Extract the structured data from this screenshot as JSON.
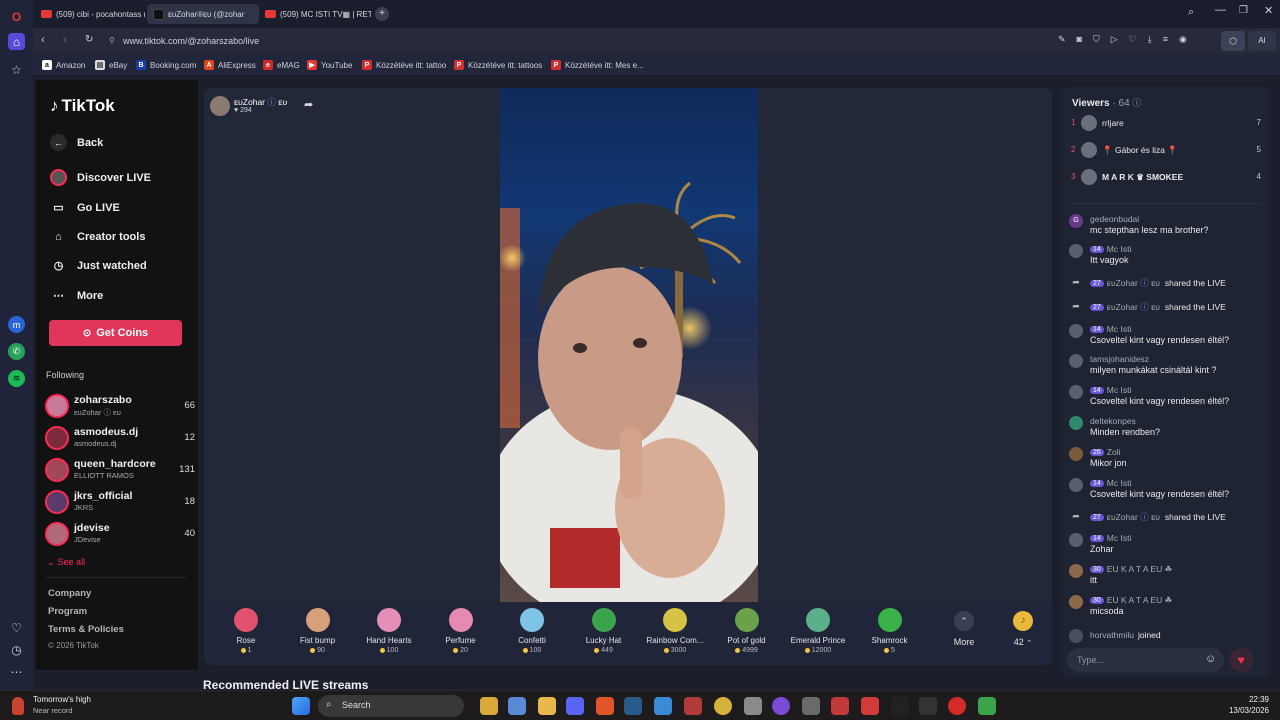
{
  "browser": {
    "tabs": [
      {
        "label": "(509) cibi - pocahontass (",
        "kind": "yt"
      },
      {
        "label": "ᴇᴜZohar®ᴇᴜ (@zohar",
        "kind": "tt"
      },
      {
        "label": "(509) MC ISTI TV▦ | RETE",
        "kind": "yt"
      }
    ],
    "new_tab_label": "+",
    "url": "www.tiktok.com/@zoharszabo/live",
    "ai_label": "AI",
    "bookmarks": [
      "Amazon",
      "eBay",
      "Booking.com",
      "AliExpress",
      "eMAG",
      "YouTube",
      "Közzétéve itt: tattoo",
      "Közzétéve itt: tattoos",
      "Közzétéve itt: Mes e..."
    ]
  },
  "sidebar": {
    "logo": "TikTok",
    "nav": [
      "Back",
      "Discover LIVE",
      "Go LIVE",
      "Creator tools",
      "Just watched",
      "More"
    ],
    "get_coins": "Get Coins",
    "following_label": "Following",
    "following": [
      {
        "user": "zoharszabo",
        "sub": "ᴇᴜZohar ⓘ ᴇᴜ",
        "count": "66",
        "color": "#c77a9a"
      },
      {
        "user": "asmodeus.dj",
        "sub": "asmodeus.dj",
        "count": "12",
        "color": "#7a2a3a"
      },
      {
        "user": "queen_hardcore",
        "sub": "ELLIOTT RAMOS",
        "count": "131",
        "color": "#a0485a"
      },
      {
        "user": "jkrs_official",
        "sub": "JKRS",
        "count": "18",
        "color": "#5a3a6a"
      },
      {
        "user": "jdevise",
        "sub": "JDevise",
        "count": "40",
        "color": "#b06a7a"
      }
    ],
    "see_all": "See all",
    "footer": [
      "Company",
      "Program",
      "Terms & Policies"
    ],
    "copyright": "© 2026 TikTok"
  },
  "stream": {
    "host_name": "ᴇᴜZohar",
    "host_suffix": "ᴇᴜ",
    "likes": "294",
    "recommended": "Recommended LIVE streams"
  },
  "gifts": [
    {
      "name": "Rose",
      "price": "1",
      "color": "#e0526f"
    },
    {
      "name": "Fist bump",
      "price": "90",
      "color": "#d8a07a"
    },
    {
      "name": "Hand Hearts",
      "price": "100",
      "color": "#e58fb6"
    },
    {
      "name": "Perfume",
      "price": "20",
      "color": "#e68ab2"
    },
    {
      "name": "Confetti",
      "price": "100",
      "color": "#7ec4e6"
    },
    {
      "name": "Lucky Hat",
      "price": "449",
      "color": "#3aa44a"
    },
    {
      "name": "Rainbow Com...",
      "price": "3000",
      "color": "#d6c244"
    },
    {
      "name": "Pot of gold",
      "price": "4999",
      "color": "#6aa24a"
    },
    {
      "name": "Emerald Prince",
      "price": "12000",
      "color": "#5ab08a"
    },
    {
      "name": "Shamrock",
      "price": "5",
      "color": "#3cb04a"
    }
  ],
  "gift_more": "More",
  "coin_count": "42",
  "chat": {
    "viewers_label": "Viewers",
    "viewers_count": "64",
    "top_viewers": [
      {
        "rank": "1",
        "name": "rrljare",
        "score": "7"
      },
      {
        "rank": "2",
        "name": "📍 Gábor és liza 📍",
        "score": "5"
      },
      {
        "rank": "3",
        "name": "M A R K ♛ SMOKEE",
        "score": "4"
      }
    ],
    "messages": [
      {
        "type": "msg",
        "name": "gedeonbudai",
        "text": "mc stepthan lesz ma brother?",
        "avatar": "#6a3a8a",
        "initial": "G"
      },
      {
        "type": "msg",
        "name": "Mc Isti",
        "badge": "14",
        "text": "Itt vagyok"
      },
      {
        "type": "share",
        "badge": "27",
        "name": "ᴇᴜZohar",
        "suffix": "ᴇᴜ",
        "text": "shared the LIVE"
      },
      {
        "type": "share",
        "badge": "27",
        "name": "ᴇᴜZohar",
        "suffix": "ᴇᴜ",
        "text": "shared the LIVE"
      },
      {
        "type": "msg",
        "name": "Mc Isti",
        "badge": "14",
        "text": "Csoveltel kint vagy rendesen éltél?"
      },
      {
        "type": "msg",
        "name": "tamsjohanidesz",
        "text": "milyen munkákat csináltál kint ?"
      },
      {
        "type": "msg",
        "name": "Mc Isti",
        "badge": "14",
        "text": "Csoveltel kint vagy rendesen éltél?"
      },
      {
        "type": "msg",
        "name": "deltekonpes",
        "text": "Minden rendben?",
        "avatar": "#2e8a6a"
      },
      {
        "type": "msg",
        "name": "Zoli",
        "badge": "26",
        "text": "Mikor jon",
        "avatar": "#7a5a3a"
      },
      {
        "type": "msg",
        "name": "Mc Isti",
        "badge": "14",
        "text": "Csoveltel kint vagy rendesen éltél?"
      },
      {
        "type": "share",
        "badge": "27",
        "name": "ᴇᴜZohar",
        "suffix": "ᴇᴜ",
        "text": "shared the LIVE"
      },
      {
        "type": "msg",
        "name": "Mc Isti",
        "badge": "14",
        "text": "Zohar"
      },
      {
        "type": "msg",
        "name": "EU K A T A EU ☘",
        "badge": "30",
        "text": "itt",
        "avatar": "#8a6a4a"
      },
      {
        "type": "msg",
        "name": "EU K A T A EU ☘",
        "badge": "30",
        "text": "micsoda",
        "avatar": "#8a6a4a"
      },
      {
        "type": "join",
        "name": "horvathmilu",
        "text": "joined"
      }
    ],
    "input_placeholder": "Type..."
  },
  "taskbar": {
    "weather_title": "Tomorrow's high",
    "weather_sub": "Near record",
    "search": "Search",
    "time": "22:39",
    "date": "13/03/2026"
  },
  "colors": {
    "tiktok_red": "#fe2c55",
    "purple_badge": "#6a58d6",
    "bg": "#1b1f2b"
  }
}
